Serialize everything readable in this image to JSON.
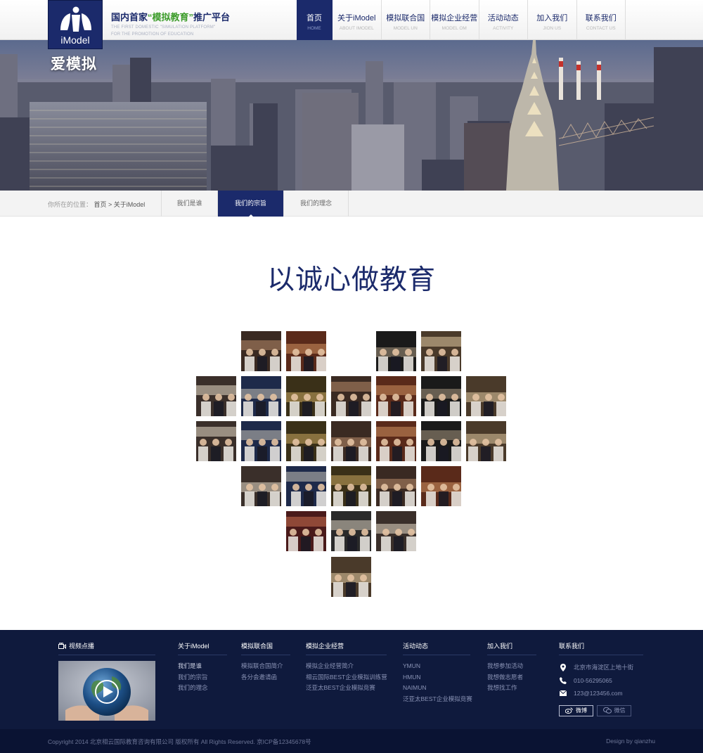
{
  "header": {
    "logo_text": "iModel",
    "slogan_part1": "国内首家",
    "slogan_highlight": "“模拟教育”",
    "slogan_part2": "推广平台",
    "slogan_en_line1": "THE FIRST DOMESTIC \"SIMULATION PLATFORM\"",
    "slogan_en_line2": "FOR THE PROMOTION OF EDUCATION",
    "nav": [
      {
        "cn": "首页",
        "en": "HOME",
        "active": true
      },
      {
        "cn": "关于iModel",
        "en": "ABOUT IMODEL",
        "active": false
      },
      {
        "cn": "模拟联合国",
        "en": "MODEL UN",
        "active": false
      },
      {
        "cn": "模拟企业经营",
        "en": "MODEL OM",
        "active": false
      },
      {
        "cn": "活动动态",
        "en": "ACTIVITY",
        "active": false
      },
      {
        "cn": "加入我们",
        "en": "JION US",
        "active": false
      },
      {
        "cn": "联系我们",
        "en": "CONTACT US",
        "active": false
      }
    ]
  },
  "banner": {
    "title": "爱模拟"
  },
  "subnav": {
    "crumb_prefix": "你所在的位置：",
    "crumb_path": "首页 > 关于iModel",
    "tabs": [
      {
        "label": "我们是谁",
        "active": false
      },
      {
        "label": "我们的宗旨",
        "active": true
      },
      {
        "label": "我们的理念",
        "active": false
      }
    ]
  },
  "main": {
    "headline": "以诚心做教育"
  },
  "footer": {
    "video": {
      "heading": "视频点播",
      "icon": "video-camera-icon"
    },
    "about": {
      "heading": "关于iModel",
      "links": [
        "我们是谁",
        "我们的宗旨",
        "我们的理念"
      ]
    },
    "mun": {
      "heading": "模拟联合国",
      "links": [
        "模拟联合国简介",
        "各分会邀请函"
      ]
    },
    "om": {
      "heading": "模拟企业经营",
      "links": [
        "模拟企业经营简介",
        "相云国际BEST企业模拟训练营",
        "泛亚太BEST企业模拟竞赛"
      ]
    },
    "activity": {
      "heading": "活动动态",
      "links": [
        "YMUN",
        "HMUN",
        "NAIMUN",
        "泛亚太BEST企业模拟竞赛"
      ]
    },
    "join": {
      "heading": "加入我们",
      "links": [
        "我想参加活动",
        "我想做志愿者",
        "我想找工作"
      ]
    },
    "contact": {
      "heading": "联系我们",
      "address": "北京市海淀区上地十街",
      "phone": "010-56295065",
      "email": "123@123456.com",
      "weibo": "微博",
      "weixin": "微信"
    }
  },
  "copyright": {
    "left": "Copyright 2014 北京相云国际教育咨询有限公司 版权所有 All Rights Reserved.    京ICP备12345678号",
    "right": "Design by qianzhu"
  },
  "colors": {
    "brand": "#1b2a6b",
    "highlight": "#3c9c2a",
    "footer": "#0f1a3d"
  }
}
